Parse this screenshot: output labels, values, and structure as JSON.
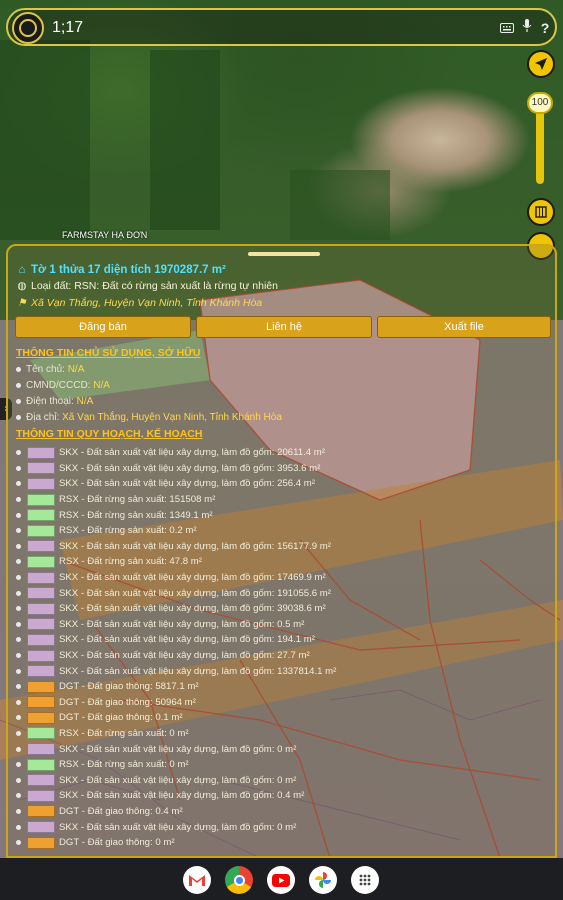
{
  "search": {
    "value": "1;17"
  },
  "map": {
    "poi_label": "FARMSTAY HẠ ĐƠN",
    "zoom_value": "100"
  },
  "panel": {
    "title": "Tờ 1 thửa 17 diện tích 1970287.7 m²",
    "land_type": "Loại đất: RSN: Đất có rừng sản xuất là rừng tự nhiên",
    "address": "Xã Vạn Thắng, Huyện Vạn Ninh, Tỉnh Khánh Hòa",
    "buttons": {
      "post": "Đăng bán",
      "contact": "Liên hệ",
      "export": "Xuất file"
    },
    "owner_section": {
      "heading": "THÔNG TIN CHỦ SỬ DỤNG, SỞ HỮU",
      "rows": [
        {
          "key": "Tên chủ: ",
          "value": "N/A"
        },
        {
          "key": "CMND/CCCD: ",
          "value": "N/A"
        },
        {
          "key": "Điện thoại: ",
          "value": "N/A"
        },
        {
          "key": "Địa chỉ: ",
          "value": "Xã Vạn Thắng, Huyện Vạn Ninh, Tỉnh Khánh Hòa"
        }
      ]
    },
    "plan_section": {
      "heading": "THÔNG TIN QUY HOẠCH, KẾ HOẠCH",
      "rows": [
        {
          "text": "SKX - Đất sản xuất vật liệu xây dựng, làm đồ gốm: 20611.4 m²",
          "color": "#c9a9cf"
        },
        {
          "text": "SKX - Đất sản xuất vật liệu xây dựng, làm đồ gốm: 3953.6 m²",
          "color": "#c9a9cf"
        },
        {
          "text": "SKX - Đất sản xuất vật liệu xây dựng, làm đồ gốm: 256.4 m²",
          "color": "#c9a9cf"
        },
        {
          "text": "RSX - Đất rừng sản xuất: 151508 m²",
          "color": "#a6e89a"
        },
        {
          "text": "RSX - Đất rừng sản xuất: 1349.1 m²",
          "color": "#a6e89a"
        },
        {
          "text": "RSX - Đất rừng sản xuất: 0.2 m²",
          "color": "#a6e89a"
        },
        {
          "text": "SKX - Đất sản xuất vật liệu xây dựng, làm đồ gốm: 156177.9 m²",
          "color": "#c9a9cf"
        },
        {
          "text": "RSX - Đất rừng sản xuất: 47.8 m²",
          "color": "#a6e89a"
        },
        {
          "text": "SKX - Đất sản xuất vật liệu xây dựng, làm đồ gốm: 17469.9 m²",
          "color": "#c9a9cf"
        },
        {
          "text": "SKX - Đất sản xuất vật liệu xây dựng, làm đồ gốm: 191055.6 m²",
          "color": "#c9a9cf"
        },
        {
          "text": "SKX - Đất sản xuất vật liệu xây dựng, làm đồ gốm: 39038.6 m²",
          "color": "#c9a9cf"
        },
        {
          "text": "SKX - Đất sản xuất vật liệu xây dựng, làm đồ gốm: 0.5 m²",
          "color": "#c9a9cf"
        },
        {
          "text": "SKX - Đất sản xuất vật liệu xây dựng, làm đồ gốm: 194.1 m²",
          "color": "#c9a9cf"
        },
        {
          "text": "SKX - Đất sản xuất vật liệu xây dựng, làm đồ gốm: 27.7 m²",
          "color": "#c9a9cf"
        },
        {
          "text": "SKX - Đất sản xuất vật liệu xây dựng, làm đồ gốm: 1337814.1 m²",
          "color": "#c9a9cf"
        },
        {
          "text": "DGT - Đất giao thông: 5817.1 m²",
          "color": "#f0a030"
        },
        {
          "text": "DGT - Đất giao thông: 50964 m²",
          "color": "#f0a030"
        },
        {
          "text": "DGT - Đất giao thông: 0.1 m²",
          "color": "#f0a030"
        },
        {
          "text": "RSX - Đất rừng sản xuất: 0 m²",
          "color": "#a6e89a"
        },
        {
          "text": "SKX - Đất sản xuất vật liệu xây dựng, làm đồ gốm: 0 m²",
          "color": "#c9a9cf"
        },
        {
          "text": "RSX - Đất rừng sản xuất: 0 m²",
          "color": "#a6e89a"
        },
        {
          "text": "SKX - Đất sản xuất vật liệu xây dựng, làm đồ gốm: 0 m²",
          "color": "#c9a9cf"
        },
        {
          "text": "SKX - Đất sản xuất vật liệu xây dựng, làm đồ gốm: 0.4 m²",
          "color": "#c9a9cf"
        },
        {
          "text": "DGT - Đất giao thông: 0.4 m²",
          "color": "#f0a030"
        },
        {
          "text": "SKX - Đất sản xuất vật liệu xây dựng, làm đồ gốm: 0 m²",
          "color": "#c9a9cf"
        },
        {
          "text": "DGT - Đất giao thông: 0 m²",
          "color": "#f0a030"
        }
      ]
    }
  },
  "dock": {
    "apps": [
      "gmail-icon",
      "chrome-icon",
      "youtube-icon",
      "photos-icon",
      "app-launcher-icon"
    ]
  },
  "colors": {
    "accent": "#f0c400",
    "title": "#52e0ff",
    "address": "#ffd84c",
    "heading": "#ffc21a"
  }
}
